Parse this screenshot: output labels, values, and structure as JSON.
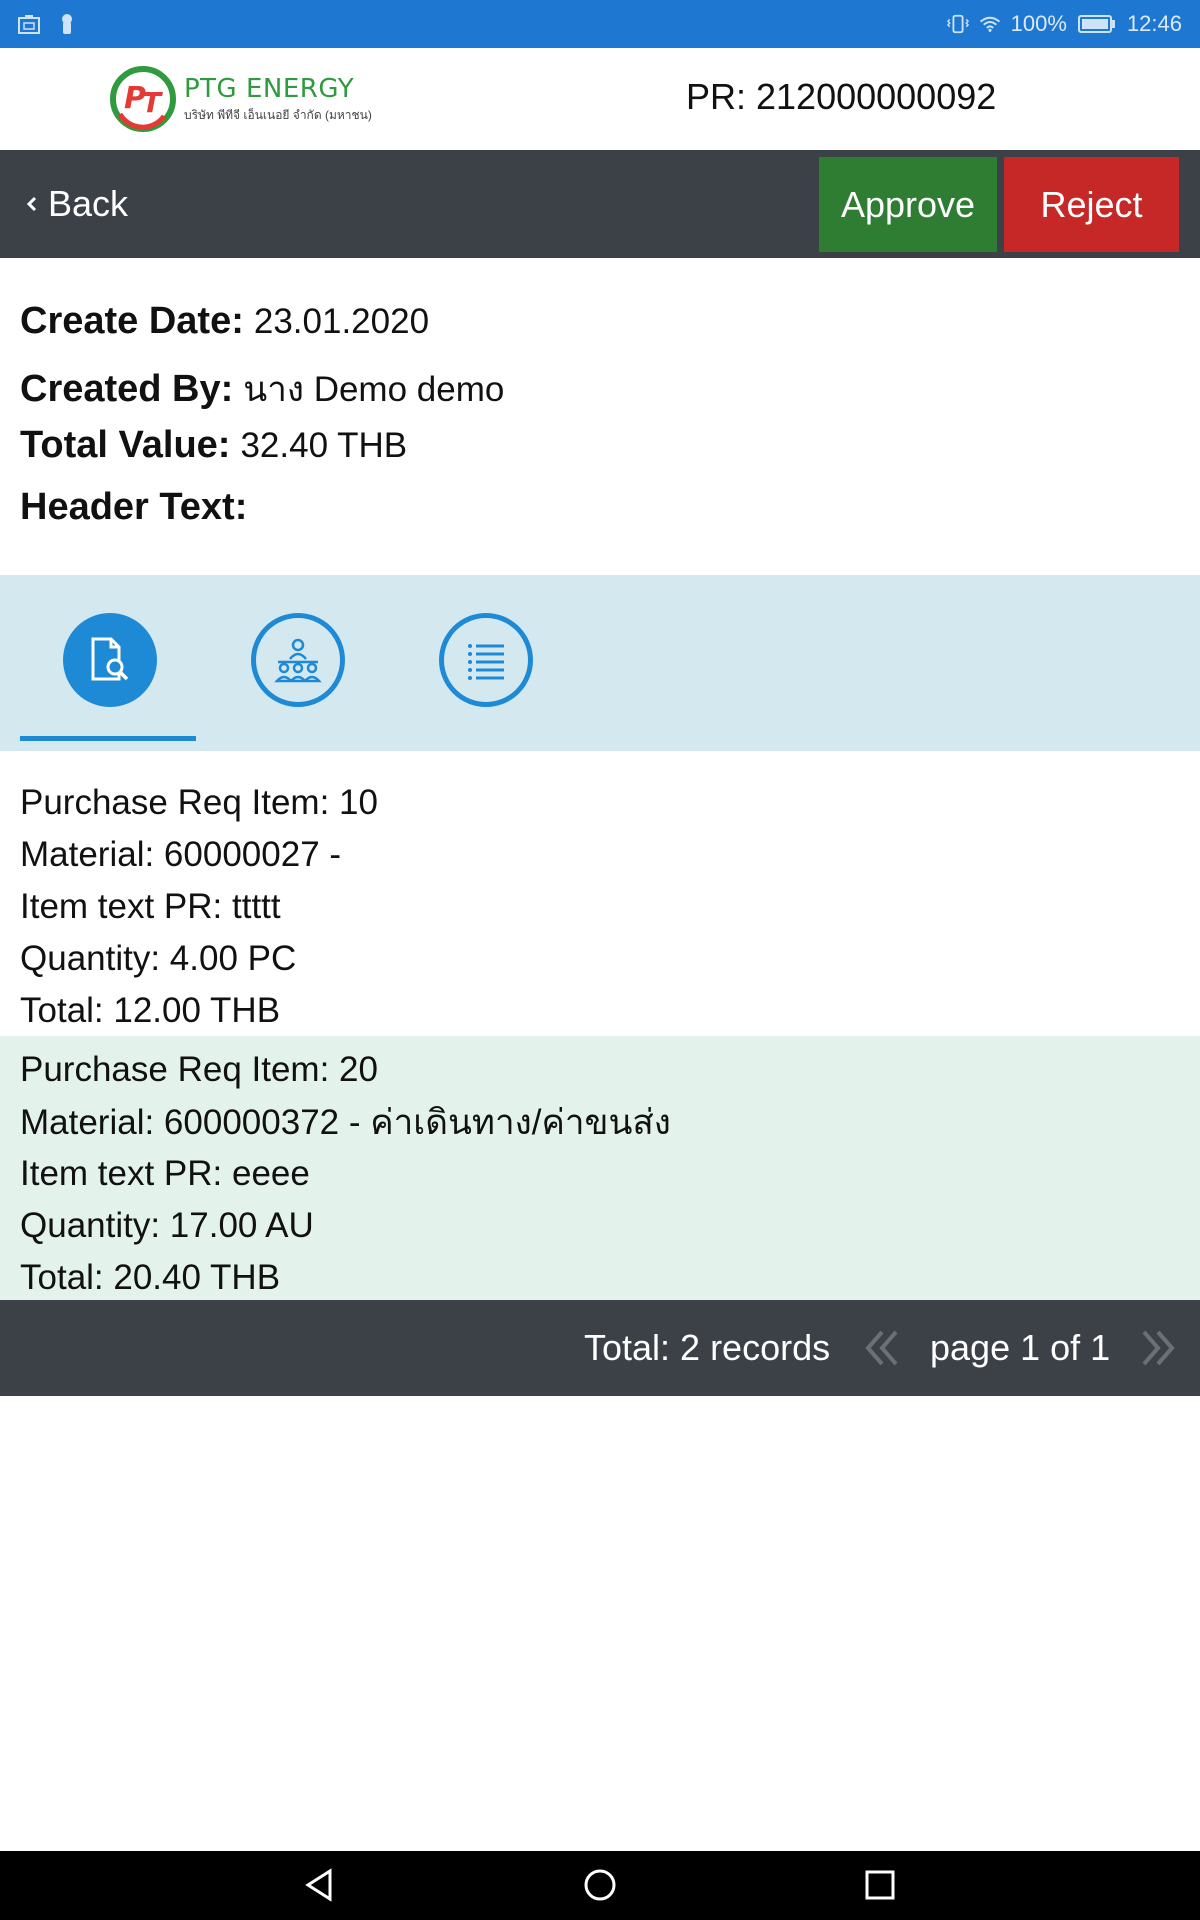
{
  "status_bar": {
    "battery": "100%",
    "time": "12:46",
    "icons": [
      "screenshot-icon",
      "key-icon",
      "vibrate-icon",
      "wifi-icon",
      "battery-icon"
    ]
  },
  "header": {
    "logo": {
      "name": "PTG ENERGY",
      "subtitle": "บริษัท พีทีจี เอ็นเนอยี จำกัด (มหาชน)"
    },
    "pr_number": "PR: 212000000092"
  },
  "toolbar": {
    "back_label": "Back",
    "approve_label": "Approve",
    "reject_label": "Reject",
    "colors": {
      "toolbar_bg": "#3c4047",
      "approve": "#2e7d32",
      "reject": "#c62828"
    }
  },
  "info": {
    "create_date_label": "Create Date:",
    "create_date": "23.01.2020",
    "created_by_label": "Created By:",
    "created_by": "นาง Demo demo",
    "total_value_label": "Total Value:",
    "total_value": "32.40 THB",
    "header_text_label": "Header Text:",
    "header_text": ""
  },
  "tabs": [
    {
      "icon": "document-search-icon",
      "active": true
    },
    {
      "icon": "people-group-icon",
      "active": false
    },
    {
      "icon": "list-icon",
      "active": false
    }
  ],
  "items": [
    {
      "purchase_req_item": "Purchase Req Item: 10",
      "material": "Material: 60000027 -",
      "item_text": "Item text PR: ttttt",
      "quantity": "Quantity: 4.00  PC",
      "total": "Total: 12.00  THB"
    },
    {
      "purchase_req_item": "Purchase Req Item: 20",
      "material": "Material: 600000372 - ค่าเดินทาง/ค่าขนส่ง",
      "item_text": "Item text PR: eeee",
      "quantity": "Quantity: 17.00  AU",
      "total": "Total: 20.40  THB"
    }
  ],
  "pager": {
    "total": "Total: 2 records",
    "page": "page 1 of 1"
  },
  "accent_color": "#1e8ad6"
}
